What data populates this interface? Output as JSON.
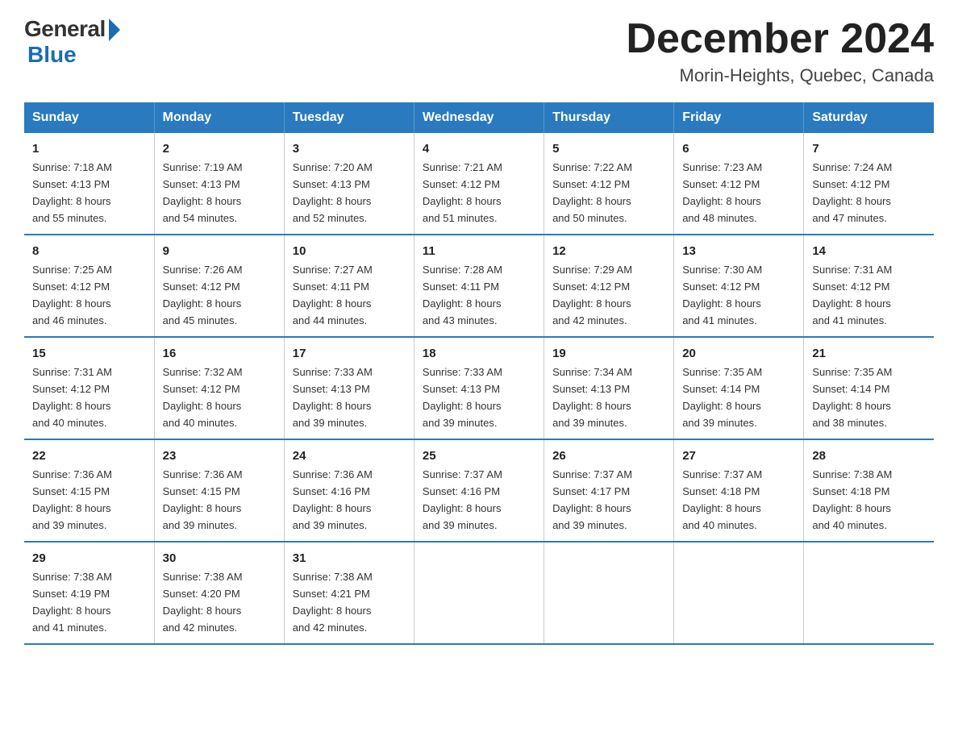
{
  "logo": {
    "general": "General",
    "blue": "Blue"
  },
  "title": {
    "month_year": "December 2024",
    "location": "Morin-Heights, Quebec, Canada"
  },
  "days_of_week": [
    "Sunday",
    "Monday",
    "Tuesday",
    "Wednesday",
    "Thursday",
    "Friday",
    "Saturday"
  ],
  "weeks": [
    [
      {
        "day": "1",
        "sunrise": "7:18 AM",
        "sunset": "4:13 PM",
        "daylight": "8 hours and 55 minutes."
      },
      {
        "day": "2",
        "sunrise": "7:19 AM",
        "sunset": "4:13 PM",
        "daylight": "8 hours and 54 minutes."
      },
      {
        "day": "3",
        "sunrise": "7:20 AM",
        "sunset": "4:13 PM",
        "daylight": "8 hours and 52 minutes."
      },
      {
        "day": "4",
        "sunrise": "7:21 AM",
        "sunset": "4:12 PM",
        "daylight": "8 hours and 51 minutes."
      },
      {
        "day": "5",
        "sunrise": "7:22 AM",
        "sunset": "4:12 PM",
        "daylight": "8 hours and 50 minutes."
      },
      {
        "day": "6",
        "sunrise": "7:23 AM",
        "sunset": "4:12 PM",
        "daylight": "8 hours and 48 minutes."
      },
      {
        "day": "7",
        "sunrise": "7:24 AM",
        "sunset": "4:12 PM",
        "daylight": "8 hours and 47 minutes."
      }
    ],
    [
      {
        "day": "8",
        "sunrise": "7:25 AM",
        "sunset": "4:12 PM",
        "daylight": "8 hours and 46 minutes."
      },
      {
        "day": "9",
        "sunrise": "7:26 AM",
        "sunset": "4:12 PM",
        "daylight": "8 hours and 45 minutes."
      },
      {
        "day": "10",
        "sunrise": "7:27 AM",
        "sunset": "4:11 PM",
        "daylight": "8 hours and 44 minutes."
      },
      {
        "day": "11",
        "sunrise": "7:28 AM",
        "sunset": "4:11 PM",
        "daylight": "8 hours and 43 minutes."
      },
      {
        "day": "12",
        "sunrise": "7:29 AM",
        "sunset": "4:12 PM",
        "daylight": "8 hours and 42 minutes."
      },
      {
        "day": "13",
        "sunrise": "7:30 AM",
        "sunset": "4:12 PM",
        "daylight": "8 hours and 41 minutes."
      },
      {
        "day": "14",
        "sunrise": "7:31 AM",
        "sunset": "4:12 PM",
        "daylight": "8 hours and 41 minutes."
      }
    ],
    [
      {
        "day": "15",
        "sunrise": "7:31 AM",
        "sunset": "4:12 PM",
        "daylight": "8 hours and 40 minutes."
      },
      {
        "day": "16",
        "sunrise": "7:32 AM",
        "sunset": "4:12 PM",
        "daylight": "8 hours and 40 minutes."
      },
      {
        "day": "17",
        "sunrise": "7:33 AM",
        "sunset": "4:13 PM",
        "daylight": "8 hours and 39 minutes."
      },
      {
        "day": "18",
        "sunrise": "7:33 AM",
        "sunset": "4:13 PM",
        "daylight": "8 hours and 39 minutes."
      },
      {
        "day": "19",
        "sunrise": "7:34 AM",
        "sunset": "4:13 PM",
        "daylight": "8 hours and 39 minutes."
      },
      {
        "day": "20",
        "sunrise": "7:35 AM",
        "sunset": "4:14 PM",
        "daylight": "8 hours and 39 minutes."
      },
      {
        "day": "21",
        "sunrise": "7:35 AM",
        "sunset": "4:14 PM",
        "daylight": "8 hours and 38 minutes."
      }
    ],
    [
      {
        "day": "22",
        "sunrise": "7:36 AM",
        "sunset": "4:15 PM",
        "daylight": "8 hours and 39 minutes."
      },
      {
        "day": "23",
        "sunrise": "7:36 AM",
        "sunset": "4:15 PM",
        "daylight": "8 hours and 39 minutes."
      },
      {
        "day": "24",
        "sunrise": "7:36 AM",
        "sunset": "4:16 PM",
        "daylight": "8 hours and 39 minutes."
      },
      {
        "day": "25",
        "sunrise": "7:37 AM",
        "sunset": "4:16 PM",
        "daylight": "8 hours and 39 minutes."
      },
      {
        "day": "26",
        "sunrise": "7:37 AM",
        "sunset": "4:17 PM",
        "daylight": "8 hours and 39 minutes."
      },
      {
        "day": "27",
        "sunrise": "7:37 AM",
        "sunset": "4:18 PM",
        "daylight": "8 hours and 40 minutes."
      },
      {
        "day": "28",
        "sunrise": "7:38 AM",
        "sunset": "4:18 PM",
        "daylight": "8 hours and 40 minutes."
      }
    ],
    [
      {
        "day": "29",
        "sunrise": "7:38 AM",
        "sunset": "4:19 PM",
        "daylight": "8 hours and 41 minutes."
      },
      {
        "day": "30",
        "sunrise": "7:38 AM",
        "sunset": "4:20 PM",
        "daylight": "8 hours and 42 minutes."
      },
      {
        "day": "31",
        "sunrise": "7:38 AM",
        "sunset": "4:21 PM",
        "daylight": "8 hours and 42 minutes."
      },
      null,
      null,
      null,
      null
    ]
  ],
  "labels": {
    "sunrise": "Sunrise:",
    "sunset": "Sunset:",
    "daylight": "Daylight:"
  }
}
